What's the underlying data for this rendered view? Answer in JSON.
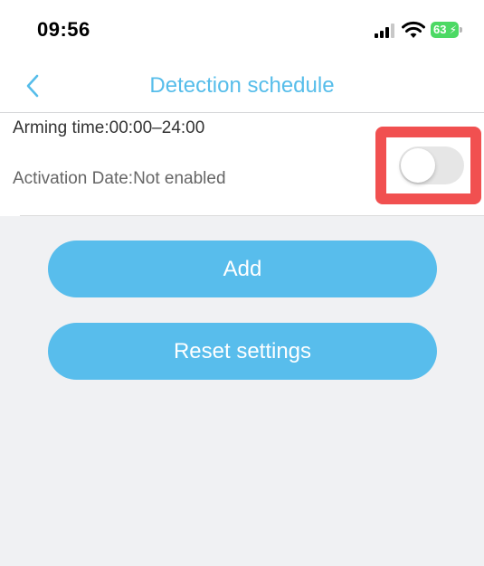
{
  "status_bar": {
    "time": "09:56",
    "battery_level": "63",
    "icons": [
      "cellular-signal-icon",
      "wifi-icon",
      "battery-charging-icon"
    ]
  },
  "nav": {
    "title": "Detection schedule",
    "back_icon": "chevron-left-icon"
  },
  "schedule": {
    "arming_time": "Arming time:00:00–24:00",
    "activation_date": "Activation Date:Not enabled",
    "enabled": false
  },
  "actions": {
    "add_label": "Add",
    "reset_label": "Reset settings"
  },
  "colors": {
    "accent": "#56bdea",
    "button": "#58bdec",
    "highlight": "#f15050",
    "battery": "#4cd964",
    "background": "#f0f1f3"
  }
}
